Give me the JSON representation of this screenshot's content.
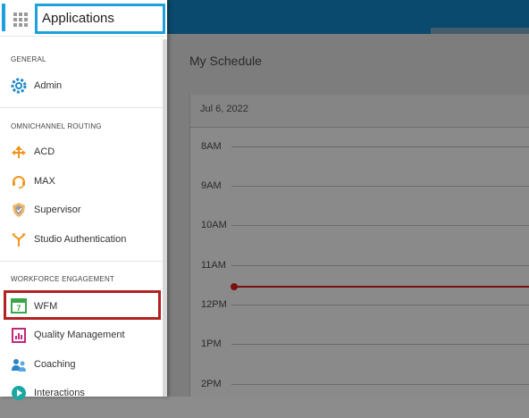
{
  "panel": {
    "title": "Applications",
    "sections": {
      "general": "GENERAL",
      "omnichannel": "OMNICHANNEL ROUTING",
      "workforce": "WORKFORCE ENGAGEMENT"
    },
    "items": {
      "admin": "Admin",
      "acd": "ACD",
      "max": "MAX",
      "supervisor": "Supervisor",
      "studio_auth": "Studio Authentication",
      "wfm": "WFM",
      "quality": "Quality Management",
      "coaching": "Coaching",
      "interactions": "Interactions"
    },
    "selected": "WFM"
  },
  "schedule": {
    "title": "My Schedule",
    "date": "Jul 6, 2022",
    "hours": [
      "8AM",
      "9AM",
      "10AM",
      "11AM",
      "12PM",
      "1PM",
      "2PM"
    ]
  },
  "colors": {
    "accent": "#1ea0dc",
    "highlight": "#b22222",
    "topbar": "#0a4a6e",
    "now_line": "#7a1010"
  },
  "icons": {
    "apps": "grid-icon",
    "admin": "gear-icon",
    "acd": "routing-icon",
    "max": "headset-icon",
    "supervisor": "shield-icon",
    "studio_auth": "branch-icon",
    "wfm": "calendar-icon",
    "quality": "chart-icon",
    "coaching": "people-icon",
    "interactions": "play-icon"
  }
}
